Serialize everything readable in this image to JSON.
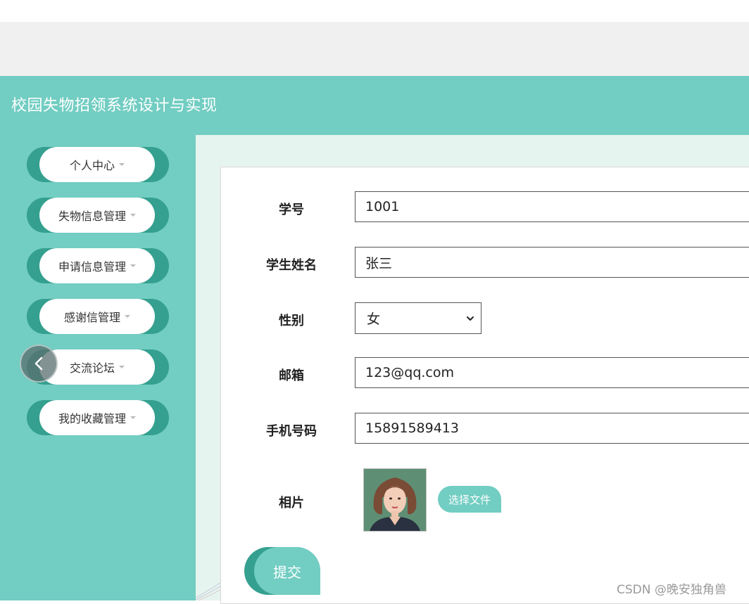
{
  "app": {
    "title": "校园失物招领系统设计与实现"
  },
  "sidebar": {
    "items": [
      {
        "label": "个人中心"
      },
      {
        "label": "失物信息管理"
      },
      {
        "label": "申请信息管理"
      },
      {
        "label": "感谢信管理"
      },
      {
        "label": "交流论坛"
      },
      {
        "label": "我的收藏管理"
      }
    ]
  },
  "form": {
    "student_id": {
      "label": "学号",
      "value": "1001"
    },
    "student_name": {
      "label": "学生姓名",
      "value": "张三"
    },
    "gender": {
      "label": "性别",
      "value": "女"
    },
    "email": {
      "label": "邮箱",
      "value": "123@qq.com"
    },
    "phone": {
      "label": "手机号码",
      "value": "15891589413"
    },
    "photo": {
      "label": "相片",
      "choose_file_label": "选择文件"
    },
    "submit_label": "提交"
  },
  "watermark": "CSDN @晚安独角兽",
  "colors": {
    "accent": "#72cdc2",
    "accent_dark": "#35a08f",
    "page_bg": "#e6f4ef"
  }
}
